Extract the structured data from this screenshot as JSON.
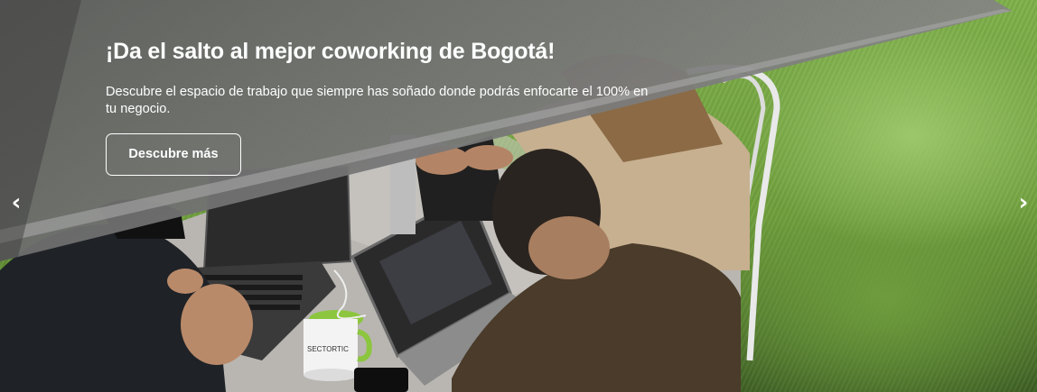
{
  "slide": {
    "title": "¡Da el salto al mejor coworking de Bogotá!",
    "description": "Descubre el espacio de trabajo que siempre has soñado donde podrás enfocarte el 100% en tu negocio.",
    "cta_label": "Descubre más",
    "mug_brand": "SECTORTIC"
  },
  "carousel": {
    "prev_glyph": "‹",
    "next_glyph": "›",
    "prev_icon": "chevron-left-icon",
    "next_icon": "chevron-right-icon"
  },
  "colors": {
    "text": "#ffffff",
    "canopy_overlay": "#6e6e6e",
    "grass": "#7fb04b",
    "mug_green": "#8cc63f"
  }
}
